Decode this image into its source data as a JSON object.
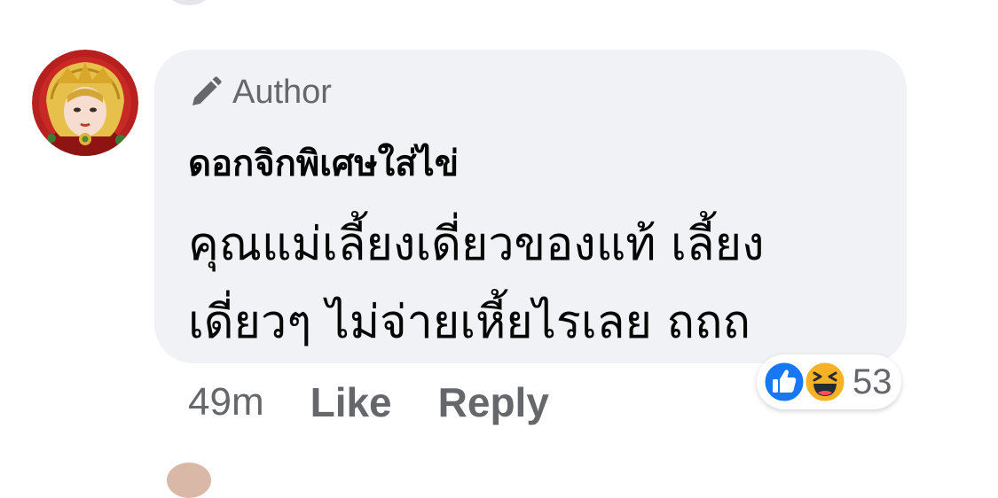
{
  "comment": {
    "author_badge": "Author",
    "author_name": "ดอกจิกพิเศษใส่ไข่",
    "text": "คุณแม่เลี้ยงเดี่ยวของแท้ เลี้ยง เดี่ยวๆ ไม่จ่ายเหี้ยไรเลย ถถถ",
    "timestamp": "49m",
    "like_label": "Like",
    "reply_label": "Reply",
    "reactions": {
      "icons": [
        "like-icon",
        "haha-icon"
      ],
      "count": "53"
    }
  },
  "colors": {
    "bubble": "#f0f2f5",
    "secondary_text": "#65676b",
    "primary_text": "#050505",
    "like_blue": "#1877f2",
    "haha_yellow": "#f7b125"
  }
}
